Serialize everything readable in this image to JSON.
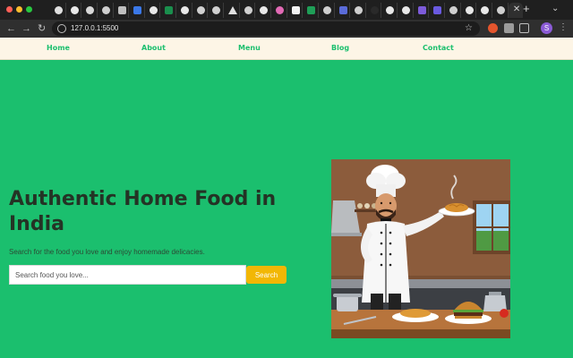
{
  "browser": {
    "url": "127.0.0.1:5500",
    "tab_icons": [
      "chrome-icon",
      "google-icon",
      "github-icon",
      "chrome-icon",
      "perplexity-icon",
      "word-icon",
      "google-icon",
      "openai-icon",
      "google-icon",
      "openai-icon",
      "openai-icon",
      "vercel-icon",
      "openai-icon",
      "google-icon",
      "dribbble-icon",
      "notion-icon",
      "webflow-icon",
      "openai-icon",
      "ai-icon",
      "openai-icon",
      "dark-icon",
      "google-icon",
      "google-icon",
      "proton-icon",
      "shield-icon",
      "openai-icon",
      "google-icon",
      "google-icon",
      "openai-icon",
      "active-tab"
    ],
    "close_glyph": "✕",
    "newtab_glyph": "+",
    "star_glyph": "☆",
    "profile_initial": "S",
    "colors": {
      "tabstrip": "#1f1f1f",
      "toolbar": "#2f2f2f",
      "omnibox": "#1c1c1c"
    }
  },
  "nav": {
    "items": [
      "Home",
      "About",
      "Menu",
      "Blog",
      "Contact"
    ],
    "bg": "#fdf5e6",
    "color": "#1bbf6e"
  },
  "hero": {
    "title": "Authentic Home Food in India",
    "subtitle": "Search for the food you love and enjoy homemade delicacies.",
    "search_placeholder": "Search food you love...",
    "search_button": "Search",
    "image_subject": "cartoon chef holding a plate of noodles beside a burger and plate of noodles",
    "bg": "#1bbf6e",
    "button_color": "#f2b705"
  }
}
